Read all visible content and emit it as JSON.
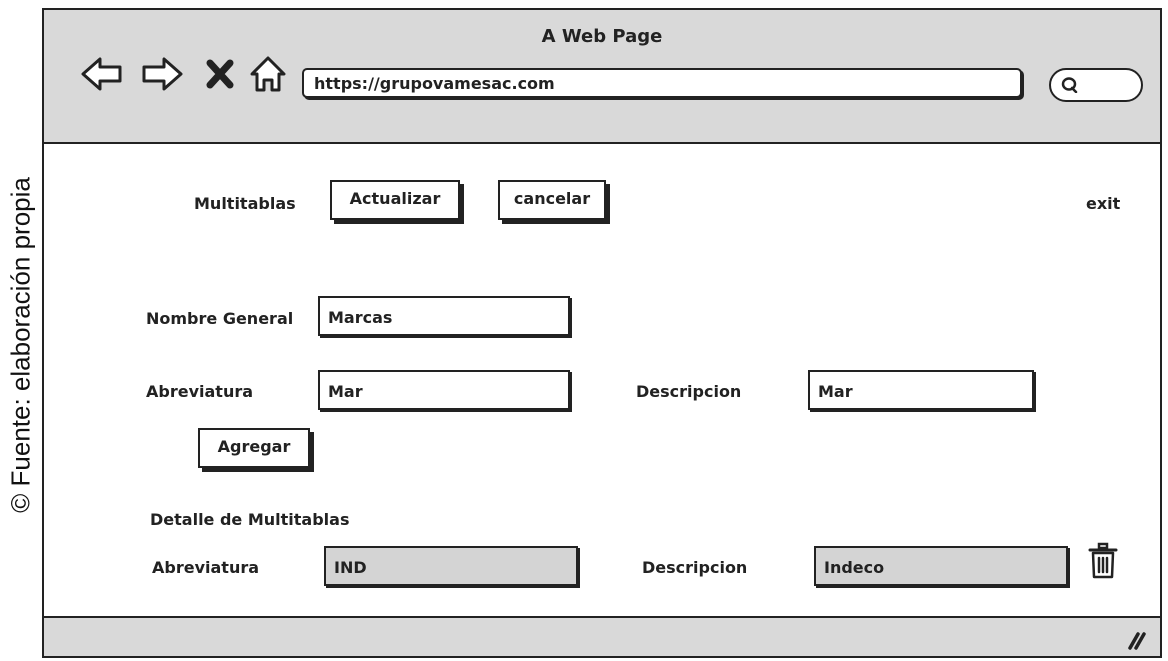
{
  "caption": "© Fuente: elaboración propia",
  "browser": {
    "title": "A Web Page",
    "url": "https://grupovamesac.com",
    "nav_icons": [
      "back-arrow-icon",
      "forward-arrow-icon",
      "close-icon",
      "home-icon"
    ]
  },
  "toolbar": {
    "section_label": "Multitablas",
    "update_label": "Actualizar",
    "cancel_label": "cancelar",
    "exit_label": "exit"
  },
  "form": {
    "general_name_label": "Nombre General",
    "general_name_value": "Marcas",
    "abbreviation_label": "Abreviatura",
    "abbreviation_value": "Mar",
    "description_label": "Descripcion",
    "description_value": "Mar",
    "add_label": "Agregar"
  },
  "detail": {
    "heading": "Detalle de Multitablas",
    "rows": [
      {
        "abbreviation_label": "Abreviatura",
        "abbreviation_value": "IND",
        "description_label": "Descripcion",
        "description_value": "Indeco",
        "delete_icon": "trash-icon"
      }
    ]
  }
}
